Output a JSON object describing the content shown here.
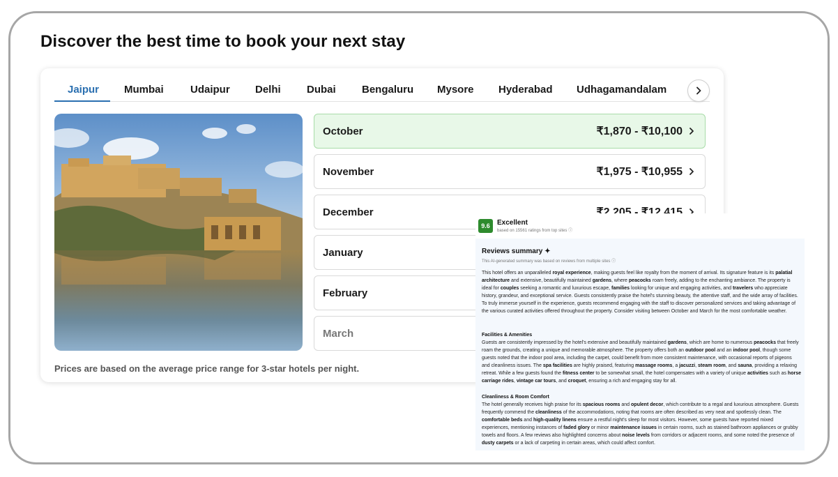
{
  "headline": "Discover the best time to book your next stay",
  "tabs": [
    {
      "label": "Jaipur",
      "active": true
    },
    {
      "label": "Mumbai"
    },
    {
      "label": "Udaipur"
    },
    {
      "label": "Delhi"
    },
    {
      "label": "Dubai"
    },
    {
      "label": "Bengaluru"
    },
    {
      "label": "Mysore"
    },
    {
      "label": "Hyderabad"
    },
    {
      "label": "Udhagamandalam"
    }
  ],
  "next_icon": "chevron-right-icon",
  "photo": {
    "subject": "Amber Fort reflected in lake",
    "colors": {
      "sky": "#7fa9d6",
      "fort": "#c9a25a",
      "water": "#6c7f84"
    }
  },
  "months": [
    {
      "name": "October",
      "price": "₹1,870 - ₹10,100",
      "highlight": true
    },
    {
      "name": "November",
      "price": "₹1,975 - ₹10,955"
    },
    {
      "name": "December",
      "price": "₹2,205 - ₹12,415"
    },
    {
      "name": "January",
      "price": ""
    },
    {
      "name": "February",
      "price": ""
    },
    {
      "name": "March",
      "price": "",
      "faded": true
    }
  ],
  "note": "Prices are based on the average price range for 3-star hotels per night.",
  "accent": "#2a6fb0",
  "highlight_bg": "#e8f8e8",
  "review": {
    "score": "9.6",
    "rating_word": "Excellent",
    "based_on": "based on 15561 ratings from top sites",
    "summary_title": "Reviews summary",
    "summary_sub": "This AI-generated summary was based on reviews from multiple sites",
    "intro": "This hotel offers an unparalleled royal experience, making guests feel like royalty from the moment of arrival. Its signature feature is its palatial architecture and extensive, beautifully maintained gardens, where peacocks roam freely, adding to the enchanting ambiance. The property is ideal for couples seeking a romantic and luxurious escape, families looking for unique and engaging activities, and travelers who appreciate history, grandeur, and exceptional service. Guests consistently praise the hotel's stunning beauty, the attentive staff, and the wide array of facilities. To truly immerse yourself in the experience, guests recommend engaging with the staff to discover personalized services and taking advantage of the various curated activities offered throughout the property. Consider visiting between October and March for the most comfortable weather.",
    "intro_bold": [
      "royal experience",
      "palatial architecture",
      "gardens",
      "peacocks",
      "couples",
      "families",
      "travelers"
    ],
    "sections": [
      {
        "heading": "Facilities & Amenities",
        "text": "Guests are consistently impressed by the hotel's extensive and beautifully maintained gardens, which are home to numerous peacocks that freely roam the grounds, creating a unique and memorable atmosphere. The property offers both an outdoor pool and an indoor pool, though some guests noted that the indoor pool area, including the carpet, could benefit from more consistent maintenance, with occasional reports of pigeons and cleanliness issues. The spa facilities are highly praised, featuring massage rooms, a jacuzzi, steam room, and sauna, providing a relaxing retreat. While a few guests found the fitness center to be somewhat small, the hotel compensates with a variety of unique activities such as horse carriage rides, vintage car tours, and croquet, ensuring a rich and engaging stay for all.",
        "bold": [
          "gardens",
          "peacocks",
          "outdoor pool",
          "indoor pool",
          "spa facilities",
          "massage rooms",
          "jacuzzi",
          "steam room",
          "sauna",
          "fitness center",
          "activities",
          "horse carriage rides",
          "vintage car tours",
          "croquet"
        ]
      },
      {
        "heading": "Cleanliness & Room Comfort",
        "text": "The hotel generally receives high praise for its spacious rooms and opulent decor, which contribute to a regal and luxurious atmosphere. Guests frequently commend the cleanliness of the accommodations, noting that rooms are often described as very neat and spotlessly clean. The comfortable beds and high-quality linens ensure a restful night's sleep for most visitors. However, some guests have reported mixed experiences, mentioning instances of faded glory or minor maintenance issues in certain rooms, such as stained bathroom appliances or grubby towels and floors. A few reviews also highlighted concerns about noise levels from corridors or adjacent rooms, and some noted the presence of dusty carpets or a lack of carpeting in certain areas, which could affect comfort.",
        "bold": [
          "spacious rooms",
          "opulent decor",
          "cleanliness",
          "comfortable beds",
          "high-quality linens",
          "faded glory",
          "maintenance issues",
          "noise levels",
          "dusty carpets"
        ]
      }
    ],
    "score_color": "#2e8b2e"
  }
}
